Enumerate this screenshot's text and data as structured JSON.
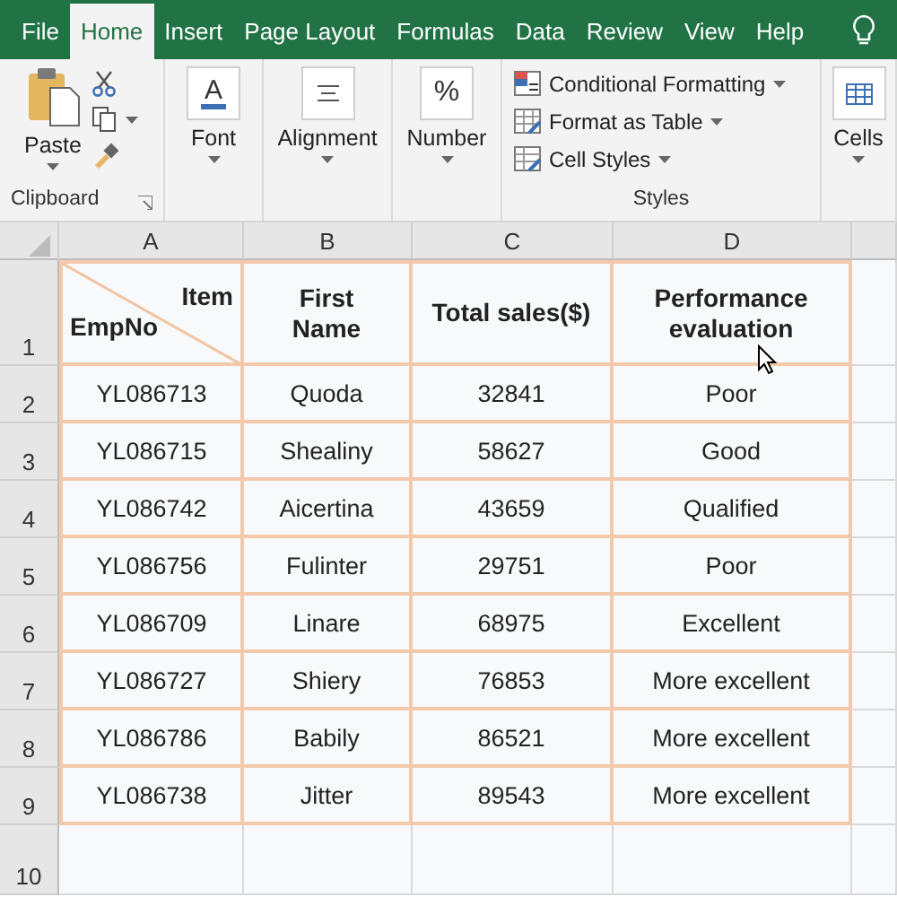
{
  "tabs": [
    {
      "label": "File",
      "selected": false
    },
    {
      "label": "Home",
      "selected": true
    },
    {
      "label": "Insert",
      "selected": false
    },
    {
      "label": "Page Layout",
      "selected": false
    },
    {
      "label": "Formulas",
      "selected": false
    },
    {
      "label": "Data",
      "selected": false
    },
    {
      "label": "Review",
      "selected": false
    },
    {
      "label": "View",
      "selected": false
    },
    {
      "label": "Help",
      "selected": false
    }
  ],
  "ribbon": {
    "groups": [
      {
        "kind": "clipboard",
        "button": "Paste",
        "label": "Clipboard"
      },
      {
        "kind": "font",
        "glyph": "A",
        "button": "Font"
      },
      {
        "kind": "alignment",
        "button": "Alignment"
      },
      {
        "kind": "number",
        "glyph": "%",
        "button": "Number"
      },
      {
        "kind": "styles",
        "items": [
          "Conditional Formatting",
          "Format as Table",
          "Cell Styles"
        ],
        "label": "Styles"
      },
      {
        "kind": "cells",
        "button": "Cells"
      }
    ]
  },
  "sheet": {
    "columns": [
      "A",
      "B",
      "C",
      "D"
    ],
    "row_numbers": [
      "1",
      "2",
      "3",
      "4",
      "5",
      "6",
      "7",
      "8",
      "9",
      "10"
    ],
    "header": {
      "item": "Item",
      "empno": "EmpNo",
      "cells": [
        "First Name",
        "Total sales($)",
        "Performance evaluation"
      ]
    },
    "rows": [
      [
        "YL086713",
        "Quoda",
        "32841",
        "Poor"
      ],
      [
        "YL086715",
        "Shealiny",
        "58627",
        "Good"
      ],
      [
        "YL086742",
        "Aicertina",
        "43659",
        "Qualified"
      ],
      [
        "YL086756",
        "Fulinter",
        "29751",
        "Poor"
      ],
      [
        "YL086709",
        "Linare",
        "68975",
        "Excellent"
      ],
      [
        "YL086727",
        "Shiery",
        "76853",
        "More excellent"
      ],
      [
        "YL086786",
        "Babily",
        "86521",
        "More excellent"
      ],
      [
        "YL086738",
        "Jitter",
        "89543",
        "More excellent"
      ]
    ]
  }
}
